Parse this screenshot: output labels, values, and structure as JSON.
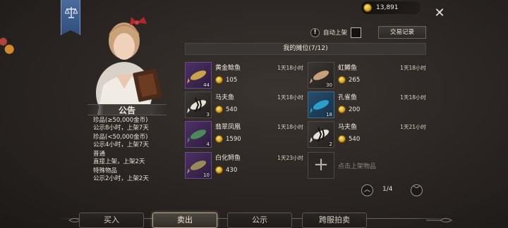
{
  "header": {
    "coins": "13,891",
    "close_icon": "close-icon",
    "auto_list_label": "自动上架",
    "trade_log_label": "交易记录"
  },
  "notice": {
    "title": "公告",
    "lines": [
      "珍品(≥50,000金币)",
      "公示8小时，上架7天",
      "珍品(<50,000金币)",
      "公示4小时，上架7天",
      "普通",
      "直接上架，上架2天",
      "特殊物品",
      "公示2小时，上架2天"
    ]
  },
  "stall": {
    "title": "我的摊位(7/12)",
    "items": [
      {
        "name": "黄金鲶鱼",
        "time": "1天18小时",
        "price": "105",
        "qty": "44",
        "frame": "purple"
      },
      {
        "name": "虹鳟鱼",
        "time": "1天18小时",
        "price": "265",
        "qty": "30",
        "frame": "grey"
      },
      {
        "name": "马夫鱼",
        "time": "1天18小时",
        "price": "540",
        "qty": "3",
        "frame": "grey"
      },
      {
        "name": "孔雀鱼",
        "time": "1天18小时",
        "price": "200",
        "qty": "18",
        "frame": "blue"
      },
      {
        "name": "翡翠凤凰",
        "time": "1天18小时",
        "price": "1590",
        "qty": "4",
        "frame": "purple"
      },
      {
        "name": "马夫鱼",
        "time": "1天21小时",
        "price": "540",
        "qty": "2",
        "frame": "grey"
      },
      {
        "name": "白化鲟鱼",
        "time": "1天23小时",
        "price": "430",
        "qty": "10",
        "frame": "purple"
      }
    ],
    "empty_slot_label": "点击上架物品"
  },
  "pager": {
    "text": "1/4"
  },
  "tabs": [
    "买入",
    "卖出",
    "公示",
    "跨服拍卖"
  ],
  "active_tab": "卖出",
  "colors": {
    "accent_gold": "#d6a21c",
    "banner_blue": "#3a5d8f",
    "active_tab_border": "#b5a88e"
  }
}
